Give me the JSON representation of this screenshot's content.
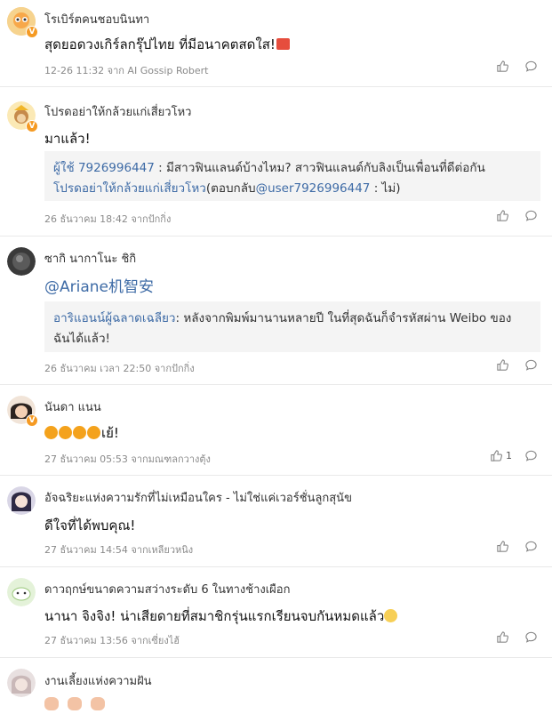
{
  "comments": [
    {
      "name": "โรเบิร์ตคนชอบนินทา",
      "text": "สุดยอดวงเกิร์ลกรุ๊ปไทย ที่มีอนาคตสดใส!",
      "meta": "12-26 11:32 จาก AI Gossip Robert",
      "likes": ""
    },
    {
      "name": "โปรดอย่าให้กล้วยแก่เสี่ยวโหว",
      "text": "มาแล้ว!",
      "quote_user": "ผู้ใช้ 7926996447",
      "quote_text": " : มีสาวฟินแลนด์บ้างไหม? สาวฟินแลนด์กับลิงเป็นเพื่อนที่ดีต่อกัน",
      "quote_user2": "โปรดอย่าให้กล้วยแก่เสี่ยวโหว",
      "quote_mid": "(ตอบกลับ",
      "quote_mention": "@user7926996447",
      "quote_end": " : ไม่)",
      "meta": "26 ธันวาคม 18:42 จากปักกิ่ง",
      "likes": ""
    },
    {
      "name": "ซากิ นากาโนะ ชิกิ",
      "text": "@Ariane机智安",
      "quote_user": "อาริแอนน์ผู้ฉลาดเฉลียว",
      "quote_text": ": หลังจากพิมพ์มานานหลายปี ในที่สุดฉันก็จำรหัสผ่าน Weibo ของ",
      "quote_line2": "ฉันได้แล้ว!",
      "meta": "26 ธันวาคม เวลา 22:50 จากปักกิ่ง",
      "likes": ""
    },
    {
      "name": "นันดา แนน",
      "text": "เย้!",
      "meta": "27 ธันวาคม 05:53 จากมณฑลกวางตุ้ง",
      "likes": "1"
    },
    {
      "name": "อัจฉริยะแห่งความรักที่ไม่เหมือนใคร - ไม่ใช่แค่เวอร์ชั่นลูกสุนัข",
      "text": "ดีใจที่ได้พบคุณ!",
      "meta": "27 ธันวาคม 14:54 จากเหลียวหนิง",
      "likes": ""
    },
    {
      "name": "ดาวฤกษ์ขนาดความสว่างระดับ 6 ในทางช้างเผือก",
      "text": "นานา จิงจิง! น่าเสียดายที่สมาชิกรุ่นแรกเรียนจบกันหมดแล้ว",
      "meta": "27 ธันวาคม 13:56 จากเซี่ยงไฮ้",
      "likes": ""
    },
    {
      "name": "งานเลี้ยงแห่งความฝัน",
      "text": "",
      "meta": "",
      "likes": ""
    }
  ],
  "icons": [
    "verified-badge-icon",
    "like-icon",
    "reply-icon",
    "emoji-icon"
  ],
  "colors": {
    "link": "#3e6ba6",
    "meta": "#8a8a8a",
    "badge": "#f59a23",
    "quote_bg": "#f4f4f4"
  }
}
